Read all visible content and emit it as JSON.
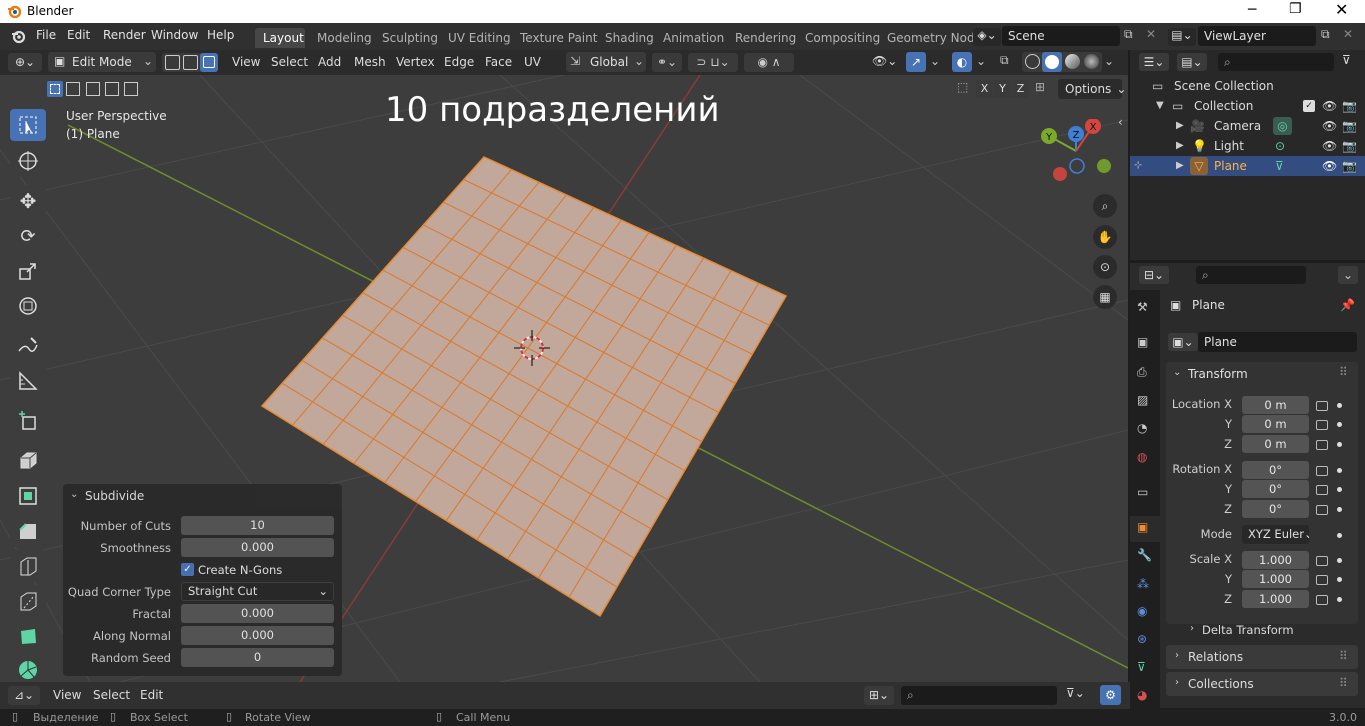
{
  "window": {
    "title": "Blender"
  },
  "menu": {
    "items": [
      "File",
      "Edit",
      "Render",
      "Window",
      "Help"
    ]
  },
  "workspaces": {
    "tabs": [
      "Layout",
      "Modeling",
      "Sculpting",
      "UV Editing",
      "Texture Paint",
      "Shading",
      "Animation",
      "Rendering",
      "Compositing",
      "Geometry Nod"
    ],
    "active": "Layout"
  },
  "scene": {
    "name": "Scene"
  },
  "viewlayer": {
    "name": "ViewLayer"
  },
  "viewport_header": {
    "mode": "Edit Mode",
    "menus": [
      "View",
      "Select",
      "Add",
      "Mesh",
      "Vertex",
      "Edge",
      "Face",
      "UV"
    ],
    "orientation": "Global",
    "options_label": "Options"
  },
  "overlay_text": {
    "perspective": "User Perspective",
    "object": "(1) Plane",
    "caption": "10 подразделений"
  },
  "gizmo": {
    "x_label": "X",
    "y_label": "Y",
    "z_label": "Z"
  },
  "operator_panel": {
    "title": "Subdivide",
    "number_of_cuts_label": "Number of Cuts",
    "number_of_cuts": "10",
    "smoothness_label": "Smoothness",
    "smoothness": "0.000",
    "create_ngons_label": "Create N-Gons",
    "create_ngons": true,
    "quad_corner_type_label": "Quad Corner Type",
    "quad_corner_type": "Straight Cut",
    "fractal_label": "Fractal",
    "fractal": "0.000",
    "along_normal_label": "Along Normal",
    "along_normal": "0.000",
    "random_seed_label": "Random Seed",
    "random_seed": "0"
  },
  "outliner": {
    "root": "Scene Collection",
    "collection": "Collection",
    "items": [
      {
        "name": "Camera"
      },
      {
        "name": "Light"
      },
      {
        "name": "Plane",
        "selected": true
      }
    ]
  },
  "properties": {
    "object_name": "Plane",
    "data_name": "Plane",
    "transform_label": "Transform",
    "location_label": "Location X",
    "location": [
      "0 m",
      "0 m",
      "0 m"
    ],
    "rotation_label": "Rotation X",
    "rotation": [
      "0°",
      "0°",
      "0°"
    ],
    "mode_label": "Mode",
    "mode": "XYZ Euler",
    "scale_label": "Scale X",
    "scale": [
      "1.000",
      "1.000",
      "1.000"
    ],
    "y_label": "Y",
    "z_label": "Z",
    "delta_label": "Delta Transform",
    "relations_label": "Relations",
    "collections_label": "Collections"
  },
  "bottom_bar": {
    "menus": [
      "View",
      "Select",
      "Edit"
    ]
  },
  "status_bar": {
    "select": "Выделение",
    "box_select": "Box Select",
    "rotate_view": "Rotate View",
    "call_menu": "Call Menu",
    "version": "3.0.0"
  },
  "colors": {
    "accent": "#4772b3",
    "selection": "#e88a2e",
    "x_axis": "#d3453f",
    "y_axis": "#7aaa2a",
    "z_axis": "#3f7fd6"
  }
}
